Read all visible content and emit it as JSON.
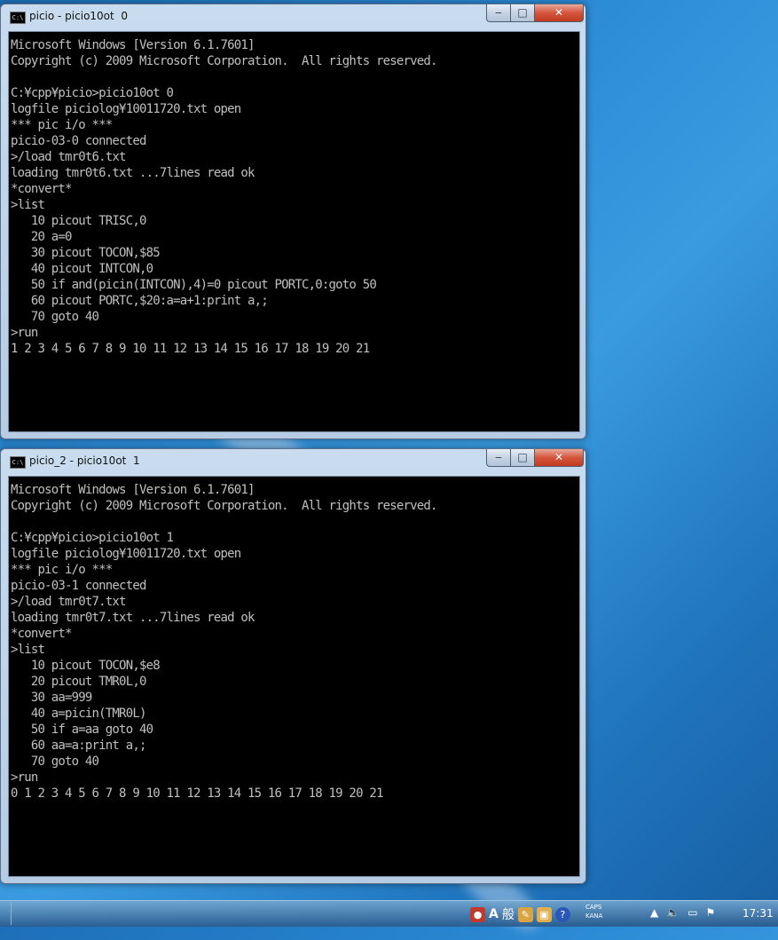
{
  "windows": [
    {
      "title": "picio - picio10ot  0",
      "lines": [
        "Microsoft Windows [Version 6.1.7601]",
        "Copyright (c) 2009 Microsoft Corporation.  All rights reserved.",
        "",
        "C:¥cpp¥picio>picio10ot 0",
        "logfile piciolog¥10011720.txt open",
        "*** pic i/o ***",
        "picio-03-0 connected",
        ">/load tmr0t6.txt",
        "loading tmr0t6.txt ...7lines read ok",
        "*convert*",
        ">list",
        "   10 picout TRISC,0",
        "   20 a=0",
        "   30 picout TOCON,$85",
        "   40 picout INTCON,0",
        "   50 if and(picin(INTCON),4)=0 picout PORTC,0:goto 50",
        "   60 picout PORTC,$20:a=a+1:print a,;",
        "   70 goto 40",
        ">run",
        "1 2 3 4 5 6 7 8 9 10 11 12 13 14 15 16 17 18 19 20 21"
      ]
    },
    {
      "title": "picio_2 - picio10ot  1",
      "lines": [
        "Microsoft Windows [Version 6.1.7601]",
        "Copyright (c) 2009 Microsoft Corporation.  All rights reserved.",
        "",
        "C:¥cpp¥picio>picio10ot 1",
        "logfile piciolog¥10011720.txt open",
        "*** pic i/o ***",
        "picio-03-1 connected",
        ">/load tmr0t7.txt",
        "loading tmr0t7.txt ...7lines read ok",
        "*convert*",
        ">list",
        "   10 picout TOCON,$e8",
        "   20 picout TMR0L,0",
        "   30 aa=999",
        "   40 a=picin(TMR0L)",
        "   50 if a=aa goto 40",
        "   60 aa=a:print a,;",
        "   70 goto 40",
        ">run",
        "0 1 2 3 4 5 6 7 8 9 10 11 12 13 14 15 16 17 18 19 20 21"
      ]
    }
  ],
  "controls": {
    "minimize": "‒",
    "maximize": "□",
    "close": "✕"
  },
  "taskbar": {
    "ime_mode": "A",
    "ime_kanji": "般",
    "caps": "CAPS",
    "kana": "KANA",
    "clock": "17:31"
  },
  "icons": [
    "console-icon",
    "minimize-icon",
    "maximize-icon",
    "close-icon",
    "ime-icon",
    "help-icon",
    "volume-icon",
    "network-icon",
    "action-center-icon",
    "show-hidden-icons"
  ]
}
